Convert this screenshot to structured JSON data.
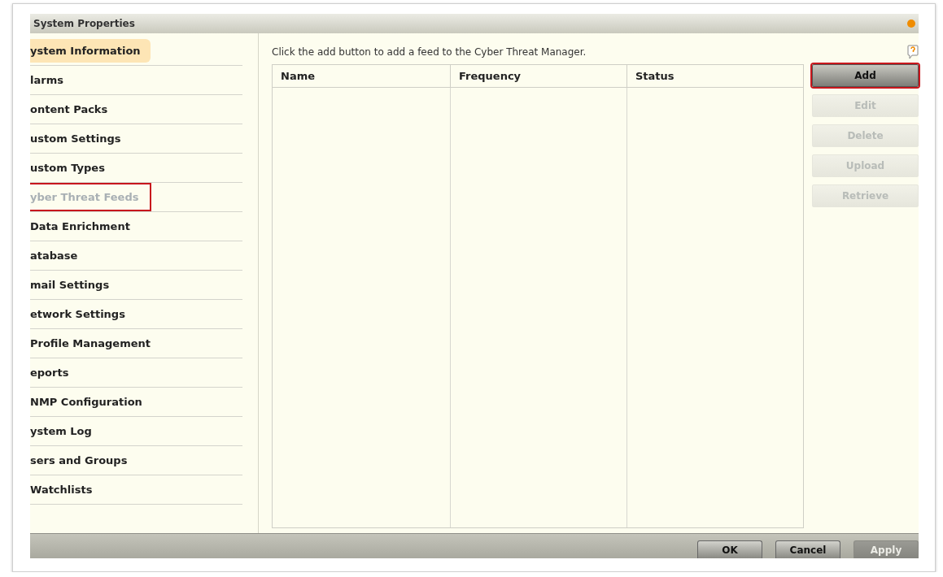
{
  "window": {
    "title": "System Properties"
  },
  "sidebar": {
    "items": [
      {
        "label": "ystem Information",
        "selected": true,
        "disabled": false,
        "highlighted": false
      },
      {
        "label": "larms",
        "selected": false,
        "disabled": false,
        "highlighted": false
      },
      {
        "label": "ontent Packs",
        "selected": false,
        "disabled": false,
        "highlighted": false
      },
      {
        "label": "ustom Settings",
        "selected": false,
        "disabled": false,
        "highlighted": false
      },
      {
        "label": "ustom Types",
        "selected": false,
        "disabled": false,
        "highlighted": false
      },
      {
        "label": "yber Threat Feeds",
        "selected": false,
        "disabled": true,
        "highlighted": true
      },
      {
        "label": "Data Enrichment",
        "selected": false,
        "disabled": false,
        "highlighted": false
      },
      {
        "label": "atabase",
        "selected": false,
        "disabled": false,
        "highlighted": false
      },
      {
        "label": "mail Settings",
        "selected": false,
        "disabled": false,
        "highlighted": false
      },
      {
        "label": "etwork Settings",
        "selected": false,
        "disabled": false,
        "highlighted": false
      },
      {
        "label": "Profile Management",
        "selected": false,
        "disabled": false,
        "highlighted": false
      },
      {
        "label": "eports",
        "selected": false,
        "disabled": false,
        "highlighted": false
      },
      {
        "label": "NMP Configuration",
        "selected": false,
        "disabled": false,
        "highlighted": false
      },
      {
        "label": "ystem Log",
        "selected": false,
        "disabled": false,
        "highlighted": false
      },
      {
        "label": "sers and Groups",
        "selected": false,
        "disabled": false,
        "highlighted": false
      },
      {
        "label": "Watchlists",
        "selected": false,
        "disabled": false,
        "highlighted": false
      }
    ]
  },
  "content": {
    "instruction": "Click the add button to add a feed to the Cyber Threat Manager.",
    "table": {
      "columns": [
        "Name",
        "Frequency",
        "Status"
      ]
    },
    "buttons": [
      {
        "label": "Add",
        "disabled": false,
        "highlighted": true
      },
      {
        "label": "Edit",
        "disabled": true,
        "highlighted": false
      },
      {
        "label": "Delete",
        "disabled": true,
        "highlighted": false
      },
      {
        "label": "Upload",
        "disabled": true,
        "highlighted": false
      },
      {
        "label": "Retrieve",
        "disabled": true,
        "highlighted": false
      }
    ]
  },
  "footer": {
    "buttons": [
      {
        "label": "OK",
        "disabled": false
      },
      {
        "label": "Cancel",
        "disabled": false
      },
      {
        "label": "Apply",
        "disabled": true
      }
    ]
  }
}
